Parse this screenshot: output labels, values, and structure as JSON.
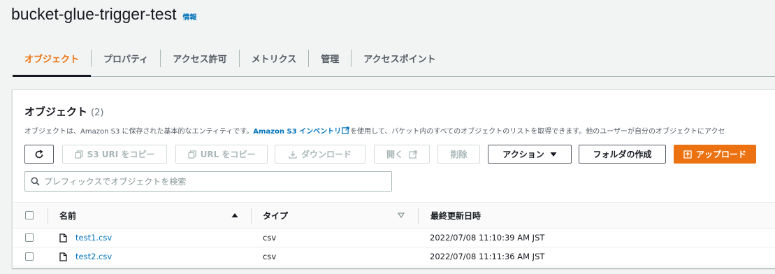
{
  "bucket": {
    "title": "bucket-glue-trigger-test",
    "info": "情報"
  },
  "tabs": [
    {
      "label": "オブジェクト"
    },
    {
      "label": "プロパティ"
    },
    {
      "label": "アクセス許可"
    },
    {
      "label": "メトリクス"
    },
    {
      "label": "管理"
    },
    {
      "label": "アクセスポイント"
    }
  ],
  "panel": {
    "title": "オブジェクト",
    "count": "(2)",
    "desc_before": "オブジェクトは、Amazon S3 に保存された基本的なエンティティです。",
    "desc_link": "Amazon S3 インベントリ",
    "desc_after": "を使用して、バケット内のすべてのオブジェクトのリストを取得できます。他のユーザーが自分のオブジェクトにアクセ"
  },
  "toolbar": {
    "copy_s3_uri": "S3 URI をコピー",
    "copy_url": "URL をコピー",
    "download": "ダウンロード",
    "open": "開く",
    "delete": "削除",
    "actions": "アクション",
    "create_folder": "フォルダの作成",
    "upload": "アップロード"
  },
  "search": {
    "placeholder": "プレフィックスでオブジェクトを検索"
  },
  "table": {
    "columns": [
      "名前",
      "タイプ",
      "最終更新日時"
    ],
    "rows": [
      {
        "name": "test1.csv",
        "type": "csv",
        "modified": "2022/07/08 11:10:39 AM JST"
      },
      {
        "name": "test2.csv",
        "type": "csv",
        "modified": "2022/07/08 11:11:36 AM JST"
      }
    ]
  },
  "colors": {
    "accent": "#ec7211",
    "link": "#0073bb",
    "text": "#16191f"
  },
  "icons": [
    "refresh-icon",
    "copy-icon",
    "download-icon",
    "external-link-icon",
    "caret-down-icon",
    "upload-icon",
    "search-icon",
    "file-icon",
    "sort-asc-icon",
    "sort-desc-icon"
  ]
}
